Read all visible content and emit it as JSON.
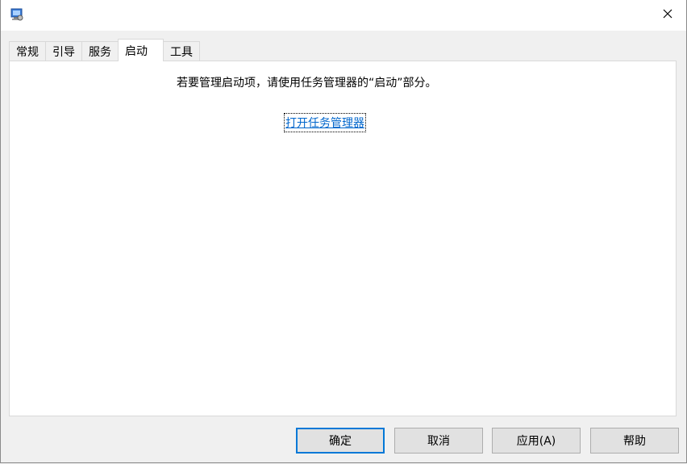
{
  "tabs": [
    {
      "label": "常规"
    },
    {
      "label": "引导"
    },
    {
      "label": "服务"
    },
    {
      "label": "启动"
    },
    {
      "label": "工具"
    }
  ],
  "active_tab": "启动",
  "startup": {
    "message": "若要管理启动项，请使用任务管理器的“启动”部分。",
    "link_label": "打开任务管理器"
  },
  "buttons": {
    "ok": "确定",
    "cancel": "取消",
    "apply": "应用(A)",
    "help": "帮助"
  },
  "colors": {
    "link": "#0066cc",
    "default_button_border": "#0078d7"
  }
}
